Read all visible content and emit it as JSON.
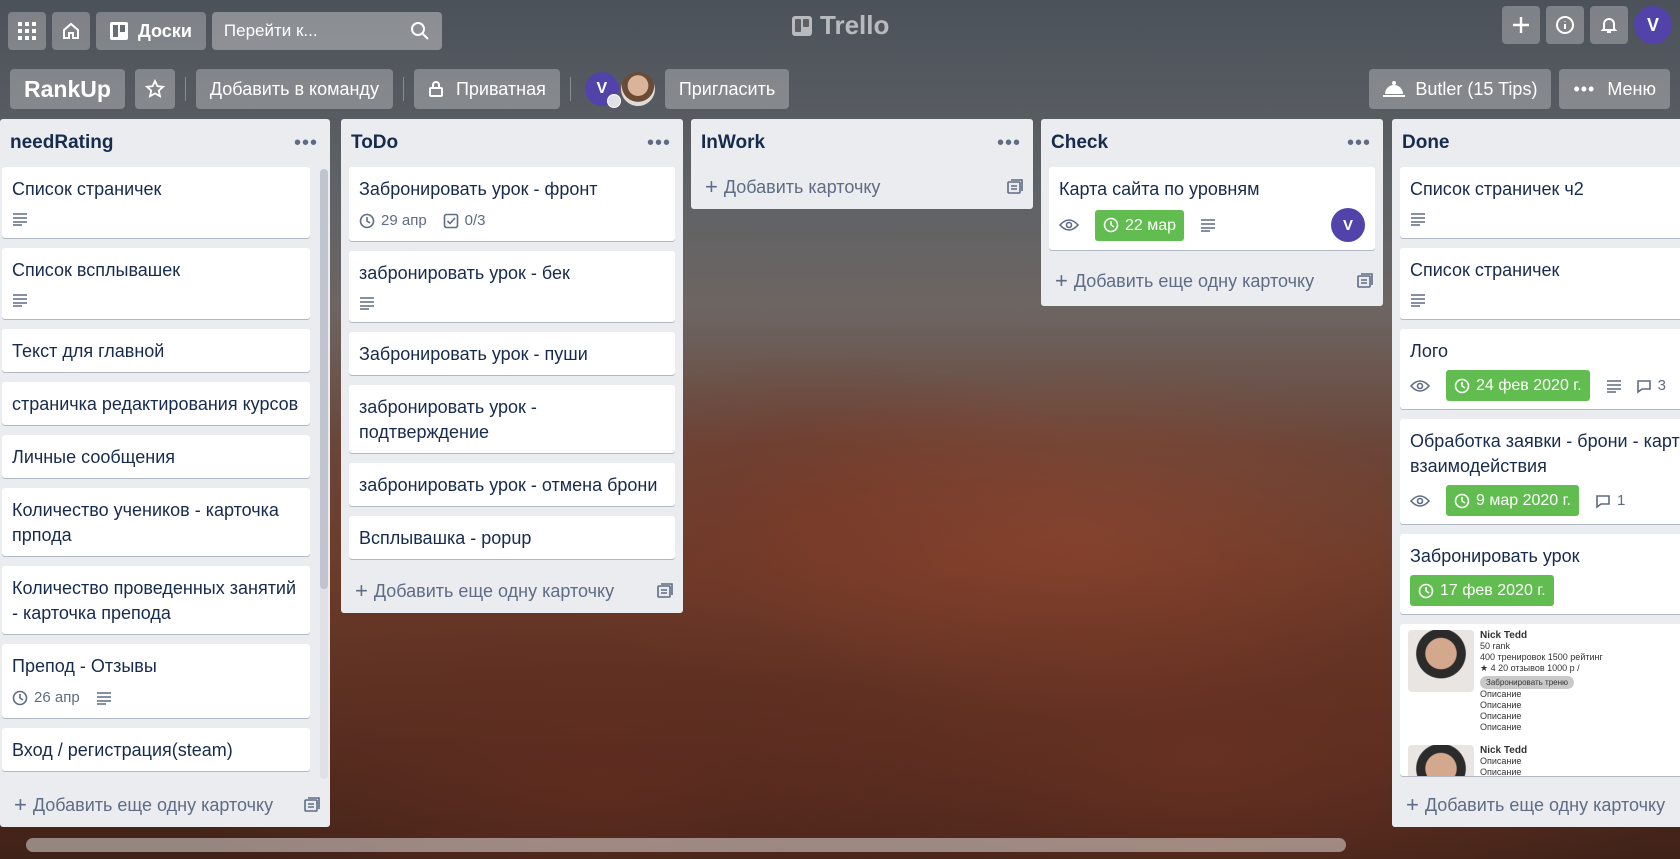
{
  "topbar": {
    "boards_label": "Доски",
    "search_placeholder": "Перейти к...",
    "logo": "Trello",
    "user_initial": "V"
  },
  "board": {
    "title": "RankUp",
    "add_team": "Добавить в команду",
    "privacy": "Приватная",
    "member_initial": "V",
    "invite": "Пригласить",
    "butler": "Butler (15 Tips)",
    "menu": "Меню"
  },
  "lists": [
    {
      "title": "needRating",
      "cards": [
        {
          "title": "Список страничек",
          "desc": true
        },
        {
          "title": "Список всплывашек",
          "desc": true
        },
        {
          "title": "Текст для главной"
        },
        {
          "title": "страничка редактирования курсов"
        },
        {
          "title": "Личные сообщения"
        },
        {
          "title": "Количество учеников - карточка прпода"
        },
        {
          "title": "Количество проведенных занятий - карточка препода"
        },
        {
          "title": "Препод - Отзывы",
          "due": "26 апр",
          "desc": true
        },
        {
          "title": "Вход / регистрация(steam)"
        }
      ],
      "add": "Добавить еще одну карточку"
    },
    {
      "title": "ToDo",
      "cards": [
        {
          "title": "Забронировать урок - фронт",
          "due": "29 апр",
          "checklist": "0/3"
        },
        {
          "title": "забронировать урок - бек",
          "desc": true
        },
        {
          "title": "Забронировать урок - пуши"
        },
        {
          "title": "забронировать урок - подтверждение"
        },
        {
          "title": "забронировать урок - отмена брони"
        },
        {
          "title": "Всплывашка - popup"
        }
      ],
      "add": "Добавить еще одну карточку"
    },
    {
      "title": "InWork",
      "cards": [],
      "add": "Добавить карточку"
    },
    {
      "title": "Check",
      "cards": [
        {
          "title": "Карта сайта по уровням",
          "watch": true,
          "due": "22 мар",
          "desc": true,
          "member": "V"
        }
      ],
      "add": "Добавить еще одну карточку"
    },
    {
      "title": "Done",
      "cards": [
        {
          "title": "Список страничек ч2",
          "desc": true
        },
        {
          "title": "Список страничек",
          "desc": true
        },
        {
          "title": "Лого",
          "watch": true,
          "due": "24 фев 2020 г.",
          "desc": true,
          "comments": "3"
        },
        {
          "title": "Обработка заявки - брони - карточка взаимодействия",
          "watch": true,
          "due": "9 мар 2020 г.",
          "comments": "1"
        },
        {
          "title": "Забронировать урок",
          "due": "17 фев 2020 г."
        }
      ],
      "preview": {
        "name1": "Nick Tedd",
        "stat1": "50 rank",
        "stat2": "400 тренировок 1500 рейтинг",
        "rating": "4",
        "reviews": "20 отзывов",
        "price": "1000 р /",
        "book": "Забронировать треню",
        "desc1": "Описание",
        "desc2": "Описание",
        "desc3": "Описание",
        "desc4": "Описание",
        "name2": "Nick Tedd",
        "desc5": "Описание",
        "desc6": "Описание"
      },
      "add": "Добавить еще одну карточку"
    }
  ]
}
